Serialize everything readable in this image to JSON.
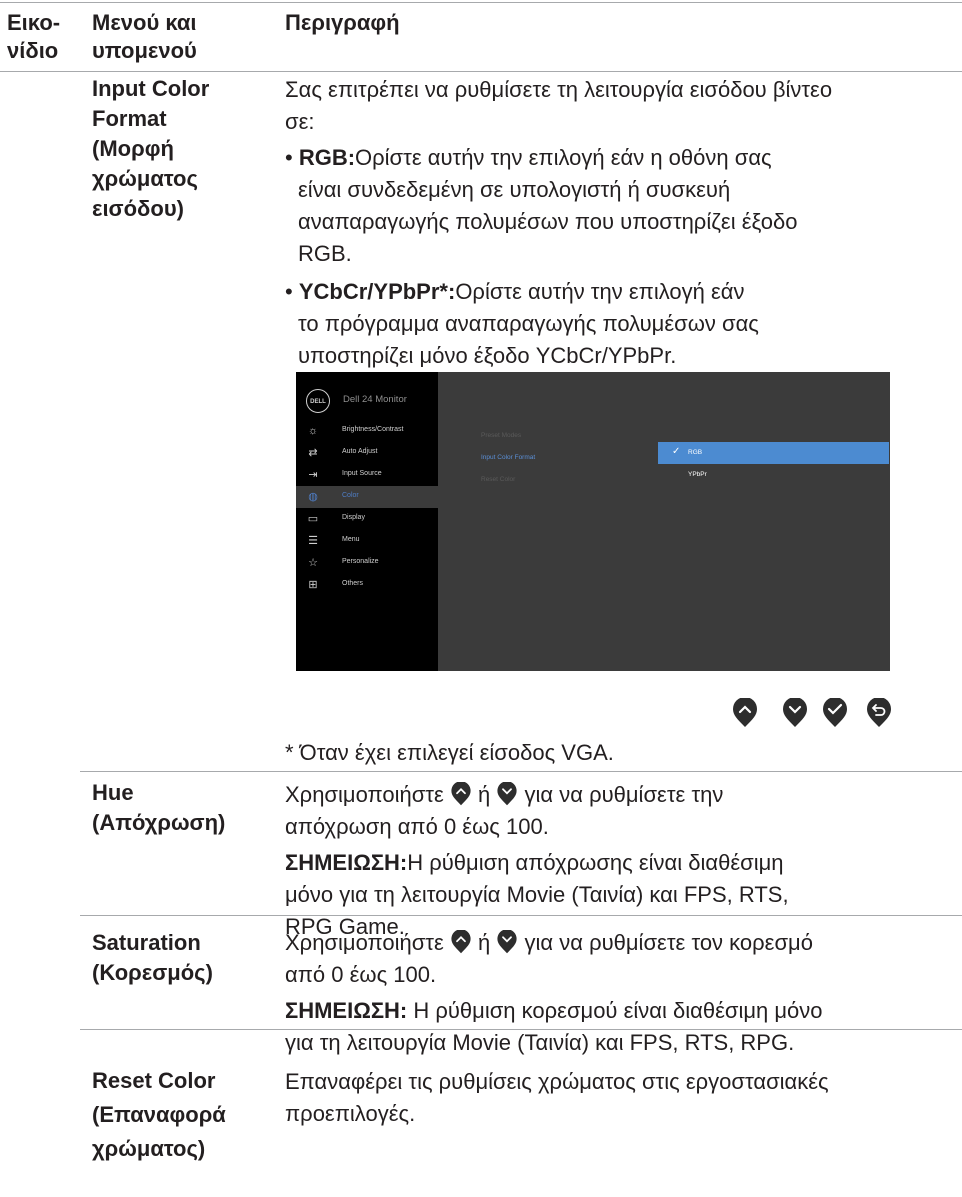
{
  "header": {
    "col1_line1": "Εικο-",
    "col1_line2": "νίδιο",
    "col2_line1": "Μενού και",
    "col2_line2": "υπομενού",
    "col3": "Περιγραφή"
  },
  "input_color_format": {
    "name_lines": [
      "Input Color",
      "Format",
      "(Μορφή",
      "χρώματος",
      "εισόδου)"
    ],
    "intro_lines": [
      "Σας επιτρέπει να ρυθμίσετε τη λειτουργία εισόδου βίντεο",
      "σε:"
    ],
    "rgb_term": "RGB:",
    "rgb_lines": [
      "Ορίστε αυτήν την επιλογή εάν η οθόνη σας",
      "είναι συνδεδεμένη σε υπολογιστή ή συσκευή",
      "αναπαραγωγής πολυμέσων που υποστηρίζει έξοδο",
      "RGB."
    ],
    "ycbcr_term": "YCbCr/YPbPr*:",
    "ycbcr_lines": [
      "Ορίστε αυτήν την επιλογή εάν",
      "το πρόγραμμα αναπαραγωγής πολυμέσων σας",
      "υποστηρίζει μόνο έξοδο YCbCr/YPbPr."
    ],
    "footnote": "* Όταν έχει επιλεγεί είσοδος VGA."
  },
  "osd": {
    "logo": "DELL",
    "title": "Dell 24 Monitor",
    "menu": [
      {
        "label": "Brightness/Contrast",
        "icon": "brightness-icon"
      },
      {
        "label": "Auto Adjust",
        "icon": "auto-adjust-icon"
      },
      {
        "label": "Input Source",
        "icon": "input-source-icon"
      },
      {
        "label": "Color",
        "icon": "color-palette-icon"
      },
      {
        "label": "Display",
        "icon": "display-icon"
      },
      {
        "label": "Menu",
        "icon": "menu-icon"
      },
      {
        "label": "Personalize",
        "icon": "star-icon"
      },
      {
        "label": "Others",
        "icon": "others-icon"
      }
    ],
    "active_menu": "Color",
    "submenu": [
      "Preset Modes",
      "Input Color Format",
      "Reset Color"
    ],
    "selected_submenu": "Input Color Format",
    "options": [
      "RGB",
      "YPbPr"
    ],
    "selected_option": "RGB",
    "accent_color": "#4c8bd1",
    "nav_buttons": [
      "up-icon",
      "down-icon",
      "check-icon",
      "back-icon"
    ]
  },
  "hue": {
    "name_lines": [
      "Hue",
      "(Απόχρωση)"
    ],
    "text_before": "Χρησιμοποιήστε",
    "text_mid": "ή",
    "text_after": "για να ρυθμίσετε την",
    "line2": "απόχρωση από 0 έως 100.",
    "note_term": "ΣΗΜΕΙΩΣΗ:",
    "note_lines": [
      "Η ρύθμιση απόχρωσης είναι διαθέσιμη",
      "μόνο για τη λειτουργία Movie (Ταινία) και FPS, RTS,",
      "RPG Game."
    ]
  },
  "saturation": {
    "name_lines": [
      "Saturation",
      "(Κορεσμός)"
    ],
    "text_before": "Χρησιμοποιήστε",
    "text_mid": "ή",
    "text_after": "για να ρυθμίσετε τον κορεσμό",
    "line2": "από 0 έως 100.",
    "note_term": "ΣΗΜΕΙΩΣΗ:",
    "note_lines": [
      " Η ρύθμιση κορεσμού είναι διαθέσιμη μόνο",
      "για τη λειτουργία Movie (Ταινία) και FPS, RTS, RPG."
    ]
  },
  "reset_color": {
    "name_lines": [
      "Reset Color",
      "(Επαναφορά",
      "χρώματος)"
    ],
    "desc_lines": [
      "Επαναφέρει τις ρυθμίσεις χρώματος στις εργοστασιακές",
      "προεπιλογές."
    ]
  }
}
